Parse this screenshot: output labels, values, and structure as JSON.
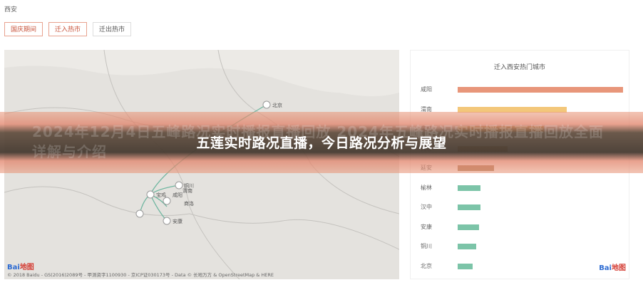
{
  "header": {
    "city": "西安"
  },
  "tabs": [
    {
      "label": "国庆期间",
      "active": true
    },
    {
      "label": "迁入热市",
      "active": true
    },
    {
      "label": "迁出热市",
      "active": false
    }
  ],
  "map": {
    "places": [
      "北京",
      "铜川",
      "宝鸡",
      "咸阳",
      "渭南",
      "商洛",
      "安康"
    ],
    "copyright": "© 2018 Baidu - GS(2016)2089号 - 甲测资字1100930 - 京ICP证030173号 - Data © 长地万方 & OpenStreetMap & HERE",
    "logo_brand": "Bai",
    "logo_suffix": "地图"
  },
  "chart": {
    "title": "迁入西安热门城市",
    "logo_brand": "Bai",
    "logo_suffix": "地图"
  },
  "chart_data": {
    "type": "bar",
    "orientation": "horizontal",
    "title": "迁入西安热门城市",
    "categories": [
      "咸阳",
      "渭南",
      "宝鸡",
      "商洛",
      "延安",
      "榆林",
      "汉中",
      "安康",
      "铜川",
      "北京"
    ],
    "values": [
      100,
      66,
      52,
      30,
      22,
      14,
      14,
      13,
      11,
      9
    ],
    "colors": [
      "#e8967a",
      "#f3c77a",
      "#f3c77a",
      "#c9a27a",
      "#b08a6a",
      "#7cc4a8",
      "#7cc4a8",
      "#7cc4a8",
      "#7cc4a8",
      "#7cc4a8"
    ],
    "xlim": [
      0,
      100
    ]
  },
  "banner": {
    "title": "五莲实时路况直播，今日路况分析与展望",
    "ghost_text": "2024年12月4日五峰路况实时播报直播回放 2024年五峰路况实时播报直播回放全面详解与介绍"
  }
}
